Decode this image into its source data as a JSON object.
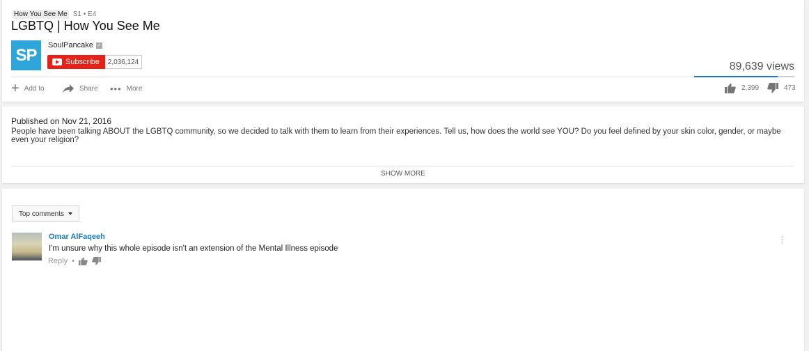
{
  "playlist": {
    "name": "How You See Me",
    "episode": "S1 • E4"
  },
  "video": {
    "title": "LGBTQ | How You See Me",
    "views": "89,639 views",
    "like_ratio": 0.835
  },
  "channel": {
    "avatar_text": "SP",
    "name": "SoulPancake",
    "subscribe_label": "Subscribe",
    "subscriber_count": "2,036,124"
  },
  "actions": {
    "add_to": "Add to",
    "share": "Share",
    "more": "More",
    "likes": "2,399",
    "dislikes": "473"
  },
  "description": {
    "published": "Published on Nov 21, 2016",
    "text": "People have been talking ABOUT the LGBTQ community, so we decided to talk with them to learn from their experiences. Tell us, how does the world see YOU? Do you feel defined by your skin color, gender, or maybe even your religion?",
    "show_more": "SHOW MORE"
  },
  "comments": {
    "sort_label": "Top comments",
    "items": [
      {
        "author": "Omar AlFaqeeh",
        "text": "I'm unsure why this whole episode isn't an extension of the Mental Illness episode",
        "reply_label": "Reply",
        "separator": "•"
      }
    ]
  },
  "colors": {
    "accent": "#167ac6",
    "subscribe_red": "#e62117",
    "channel_blue": "#2ea6d9"
  }
}
